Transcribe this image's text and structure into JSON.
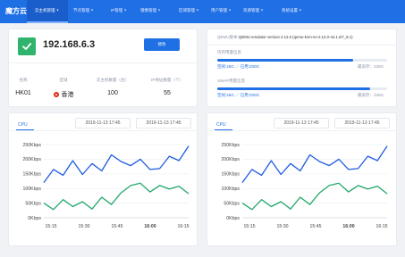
{
  "app": {
    "logo": "魔方云",
    "nav": [
      {
        "label": "云主机管理",
        "active": true
      },
      {
        "label": "节点管理",
        "active": false
      },
      {
        "label": "IP管理",
        "active": false
      },
      {
        "label": "镜像管理",
        "active": false
      },
      {
        "label": "区域管理",
        "active": false
      },
      {
        "label": "用户管理",
        "active": false
      },
      {
        "label": "资源管理",
        "active": false
      },
      {
        "label": "系统设置",
        "active": false
      }
    ]
  },
  "server": {
    "ip": "192.168.6.3",
    "action_label": "修改",
    "headers": [
      "名称",
      "区域",
      "云主机数量（台）",
      "IP地址数量（个）"
    ],
    "name": "HK01",
    "region": "香港",
    "host_count": "100",
    "ip_count": "55"
  },
  "resources": {
    "qemu_label": "QEMU版本：",
    "qemu_value": "QEMU emulator version 2.12.0 (qemu-kvm-ev-2.12.0-44.1.el7_8.1)",
    "memory": {
      "title": "内存用量信息",
      "used_fraction": 0.8,
      "detail": "空闲:25G ／ 已用:200G",
      "max": "最高存：225G"
    },
    "swap": {
      "title": "SWAP用量信息",
      "used_fraction": 0.9,
      "detail": "空闲:25G ／ 已用:200G",
      "max": "最高存：225G"
    }
  },
  "charts_meta": [
    {
      "tab": "CPU",
      "date_start": "2019-11-13 17:45",
      "date_end": "2019-11-13 17:45"
    },
    {
      "tab": "CPU",
      "date_start": "2019-11-13 17:45",
      "date_end": "2019-11-13 17:45"
    }
  ],
  "colors": {
    "primary": "#1f6fe5",
    "success": "#2fb36d",
    "series_blue": "#1f5ce0",
    "series_green": "#22a86b"
  },
  "chart_data": [
    {
      "type": "line",
      "title": "",
      "x_ticks": [
        "15:15",
        "15:30",
        "15:45",
        "16:00",
        "16:15"
      ],
      "y_ticks": [
        "0Kbps",
        "50Kbps",
        "100Kbps",
        "150Kbps",
        "200Kbps",
        "250Kbps"
      ],
      "ylim": [
        0,
        250
      ],
      "grid": true,
      "series": [
        {
          "values": [
            120,
            165,
            145,
            195,
            148,
            185,
            160,
            215,
            192,
            178,
            200,
            165,
            168,
            210,
            195,
            245
          ]
        },
        {
          "values": [
            50,
            28,
            62,
            38,
            55,
            30,
            70,
            45,
            85,
            110,
            118,
            88,
            110,
            98,
            108,
            82
          ]
        }
      ]
    },
    {
      "type": "line",
      "title": "",
      "x_ticks": [
        "15:15",
        "15:30",
        "15:45",
        "16:00",
        "16:15"
      ],
      "y_ticks": [
        "0Kbps",
        "50Kbps",
        "100Kbps",
        "150Kbps",
        "200Kbps",
        "250Kbps"
      ],
      "ylim": [
        0,
        250
      ],
      "grid": true,
      "series": [
        {
          "values": [
            120,
            165,
            145,
            195,
            148,
            185,
            160,
            215,
            192,
            178,
            200,
            165,
            168,
            210,
            195,
            245
          ]
        },
        {
          "values": [
            50,
            28,
            62,
            38,
            55,
            30,
            70,
            45,
            85,
            110,
            118,
            88,
            110,
            98,
            108,
            82
          ]
        }
      ]
    }
  ]
}
